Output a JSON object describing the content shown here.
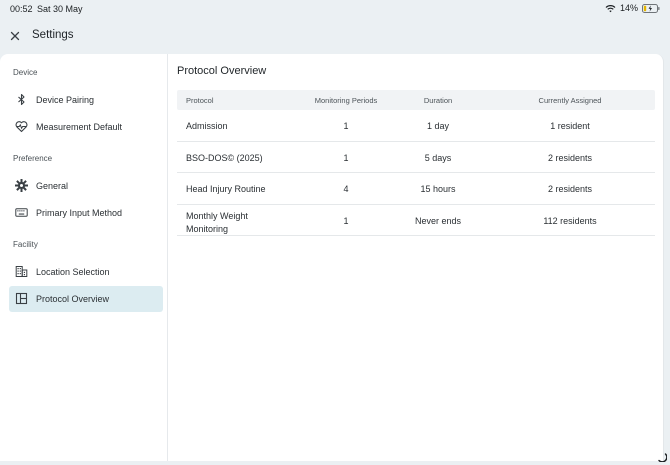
{
  "status": {
    "time": "00:52",
    "date": "Sat 30 May",
    "battery": "14%"
  },
  "header": {
    "title": "Settings"
  },
  "sidebar": {
    "sections": [
      {
        "label": "Device",
        "items": [
          {
            "label": "Device Pairing",
            "icon": "bluetooth-icon"
          },
          {
            "label": "Measurement Default",
            "icon": "heart-pulse-icon"
          }
        ]
      },
      {
        "label": "Preference",
        "items": [
          {
            "label": "General",
            "icon": "gear-icon"
          },
          {
            "label": "Primary Input Method",
            "icon": "keyboard-icon"
          }
        ]
      },
      {
        "label": "Facility",
        "items": [
          {
            "label": "Location Selection",
            "icon": "building-icon"
          },
          {
            "label": "Protocol Overview",
            "icon": "layout-icon",
            "active": true
          }
        ]
      }
    ]
  },
  "main": {
    "title": "Protocol Overview",
    "columns": [
      "Protocol",
      "Monitoring Periods",
      "Duration",
      "Currently Assigned"
    ],
    "rows": [
      [
        "Admission",
        "1",
        "1 day",
        "1 resident"
      ],
      [
        "BSO-DOS© (2025)",
        "1",
        "5 days",
        "2 residents"
      ],
      [
        "Head Injury Routine",
        "4",
        "15 hours",
        "2 residents"
      ],
      [
        "Monthly Weight Monitoring",
        "1",
        "Never ends",
        "112 residents"
      ]
    ]
  },
  "colors": {
    "background": "#ebf0f3",
    "active_item": "#dcecf1",
    "header_row": "#f1f3f5"
  }
}
